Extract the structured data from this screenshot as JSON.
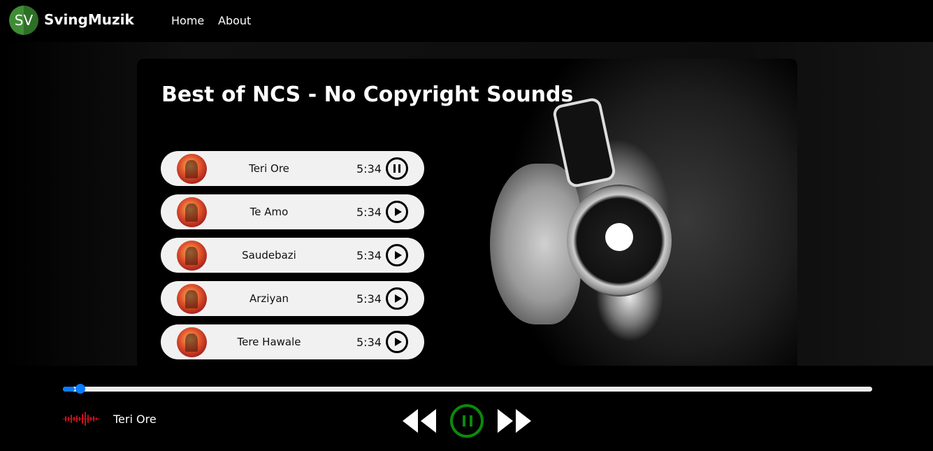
{
  "nav": {
    "logo_text": "SV",
    "brand": "SvingMuzik",
    "links": [
      "Home",
      "About"
    ]
  },
  "playlist": {
    "title": "Best of NCS - No Copyright Sounds",
    "songs": [
      {
        "name": "Teri Ore",
        "duration": "5:34",
        "state": "pause-icon"
      },
      {
        "name": "Te Amo",
        "duration": "5:34",
        "state": "play-icon"
      },
      {
        "name": "Saudebazi",
        "duration": "5:34",
        "state": "play-icon"
      },
      {
        "name": "Arziyan",
        "duration": "5:34",
        "state": "play-icon"
      },
      {
        "name": "Tere Hawale",
        "duration": "5:34",
        "state": "play-icon"
      }
    ]
  },
  "player": {
    "now_playing": "Teri Ore",
    "progress_fraction": 0.015,
    "accent_color": "#0a7cff",
    "play_color": "#0a8a0a",
    "wave_color": "#c0111a",
    "controls": [
      "previous-icon",
      "pause-icon",
      "next-icon"
    ]
  }
}
